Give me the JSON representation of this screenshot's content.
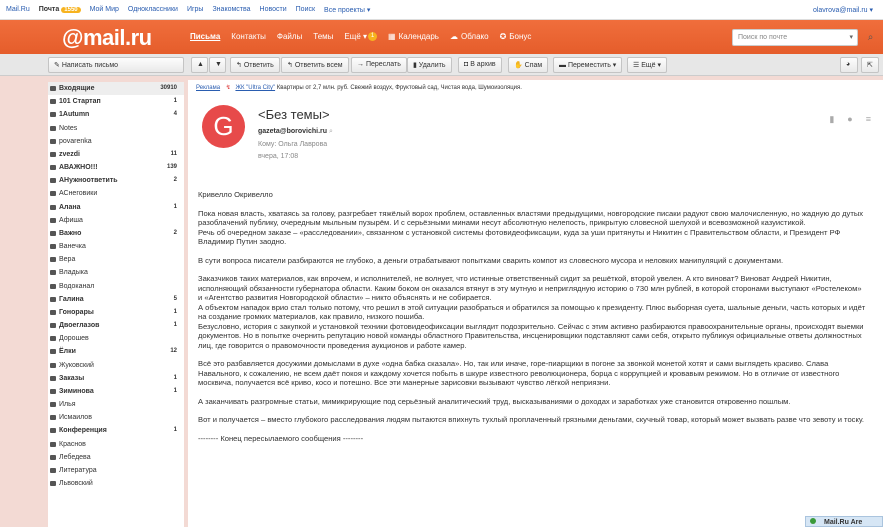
{
  "topbar": {
    "links": [
      "Mail.Ru",
      "Почта",
      "Мой Мир",
      "Одноклассники",
      "Игры",
      "Знакомства",
      "Новости",
      "Поиск",
      "Все проекты ▾"
    ],
    "mail_badge": "1550",
    "user": "olavrova@mail.ru ▾"
  },
  "header": {
    "logo": "@mail.ru",
    "nav": [
      "Письма",
      "Контакты",
      "Файлы",
      "Темы",
      "Ещё ▾",
      "Календарь",
      "Облако",
      "Бонус"
    ],
    "ещё_badge": "1",
    "search_placeholder": "Поиск по почте",
    "colors": {
      "accent": "#f06e3c"
    }
  },
  "toolbar": {
    "compose": "Написать письмо",
    "reply": "Ответить",
    "reply_all": "Ответить всем",
    "forward": "Переслать",
    "delete": "Удалить",
    "archive": "В архив",
    "spam": "Спам",
    "move": "Переместить ▾",
    "more": "Ещё ▾"
  },
  "sidebar": {
    "folders": [
      {
        "name": "Входящие",
        "count": "30910",
        "bold": true,
        "active": true
      },
      {
        "name": "101 Стартап",
        "count": "1",
        "bold": true
      },
      {
        "name": "1Autumn",
        "count": "4",
        "bold": true
      },
      {
        "name": "Notes",
        "count": "",
        "bold": false
      },
      {
        "name": "povarenka",
        "count": "",
        "bold": false
      },
      {
        "name": "zvezdi",
        "count": "11",
        "bold": true
      },
      {
        "name": "АВАЖНО!!!",
        "count": "139",
        "bold": true
      },
      {
        "name": "АНужноответить",
        "count": "2",
        "bold": true
      },
      {
        "name": "АСнеговики",
        "count": "",
        "bold": false
      },
      {
        "name": "Алана",
        "count": "1",
        "bold": true
      },
      {
        "name": "Афиша",
        "count": "",
        "bold": false
      },
      {
        "name": "Важно",
        "count": "2",
        "bold": true
      },
      {
        "name": "Ванечка",
        "count": "",
        "bold": false
      },
      {
        "name": "Вера",
        "count": "",
        "bold": false
      },
      {
        "name": "Владыка",
        "count": "",
        "bold": false
      },
      {
        "name": "Водоканал",
        "count": "",
        "bold": false
      },
      {
        "name": "Галина",
        "count": "5",
        "bold": true
      },
      {
        "name": "Гонорары",
        "count": "1",
        "bold": true
      },
      {
        "name": "Двоеглазов",
        "count": "1",
        "bold": true
      },
      {
        "name": "Дорошев",
        "count": "",
        "bold": false
      },
      {
        "name": "Ёлки",
        "count": "12",
        "bold": true
      },
      {
        "name": "Жуковский",
        "count": "",
        "bold": false
      },
      {
        "name": "Заказы",
        "count": "1",
        "bold": true
      },
      {
        "name": "Зиминова",
        "count": "1",
        "bold": true
      },
      {
        "name": "Илья",
        "count": "",
        "bold": false
      },
      {
        "name": "Исмаилов",
        "count": "",
        "bold": false
      },
      {
        "name": "Конференция",
        "count": "1",
        "bold": true
      },
      {
        "name": "Краснов",
        "count": "",
        "bold": false
      },
      {
        "name": "Лебедева",
        "count": "",
        "bold": false
      },
      {
        "name": "Литература",
        "count": "",
        "bold": false
      },
      {
        "name": "Львовский",
        "count": "",
        "bold": false
      }
    ]
  },
  "ad": {
    "tag": "Реклама",
    "link": "ЖК \"Ultra City\"",
    "text": "Квартиры от 2,7 млн. руб. Свежий воздух, Фруктовый сад, Чистая вода, Шумоизоляция."
  },
  "message": {
    "avatar_letter": "G",
    "subject": "<Без темы>",
    "from": "gazeta@borovichi.ru",
    "to": "Кому: Ольга Лаврова",
    "date": "вчера, 17:08",
    "paragraphs": [
      "Кривелло Окривелло",
      "",
      "Пока новая власть, хватаясь за голову, разгребает тяжёлый ворох проблем, оставленных властями предыдущими, новгородские писаки радуют свою малочисленную, но жадную до дутых разоблачений публику, очередным мыльным пузырём. И с серьёзными минами несут абсолютную нелепость, прикрытую словесной шелухой и всевозможной казуистикой.",
      "Речь об очередном заказе – «расследовании», связанном с установкой системы фотовидеофиксации, куда за уши притянуты и Никитин с Правительством области, и Президент РФ Владимир Путин заодно.",
      "",
      "В сути вопроса писатели разбираются не глубоко, а деньги отрабатывают попытками сварить компот из словесного мусора и неловких манипуляций с документами.",
      "",
      "Заказчиков таких материалов, как впрочем, и исполнителей, не волнует, что истинные ответственный сидит за решёткой, второй увелен. А кто виноват? Виноват Андрей Никитин, исполняющий обязанности губернатора области. Каким боком он оказался втянут в эту мутную и неприглядную историю о 730 млн рублей, в которой сторонами выступают «Ростелеком» и «Агентство развития Новгородской области» – никто объяснять и не собирается.",
      "А объектом нападок врио стал только потому, что решил в этой ситуации разобраться и обратился за помощью к президенту. Плюс выборная суета, шальные деньги, часть которых и идёт на создание громких материалов, как правило, низкого пошиба.",
      "Безусловно, история с закупкой и установкой техники фотовидеофиксации выглядит подозрительно. Сейчас с этим активно разбираются правоохранительные органы, происходят выемки документов. Но в попытке очернить репутацию новой команды областного Правительства, инсценировщики подставляют сами себя, открыто публикуя официальные ответы должностных лиц, где говорится о правомочности проведения аукционов и работе камер.",
      "",
      "Всё это разбавляется досужими домыслами в духе «одна бабка сказала». Но, так или иначе, горе-пиарщики в погоне за звонкой монетой хотят и сами выглядеть красиво. Слава Навального, к сожалению, не всем даёт покоя и каждому хочется побыть в шкуре известного революционера, борца с коррупцией и кровавым режимом. Но в отличие от известного москвича, получается всё криво, косо и потешно. Все эти манерные зарисовки вызывают чувство лёгкой неприязни.",
      "",
      "А заканчивать разгромные статьи, мимикрирующие под серьёзный аналитический труд, высказываниями о доходах и заработках уже становится откровенно пошлым.",
      "",
      "Вот и получается – вместо глубокого расследования людям пытаются впихнуть тухлый проплаченный грязными деньгами, скучный товар, который может вызвать разве что зевоту и тоску.",
      "",
      "-------- Конец пересылаемого сообщения --------"
    ]
  },
  "widget": {
    "label": "Mail.Ru Are"
  }
}
